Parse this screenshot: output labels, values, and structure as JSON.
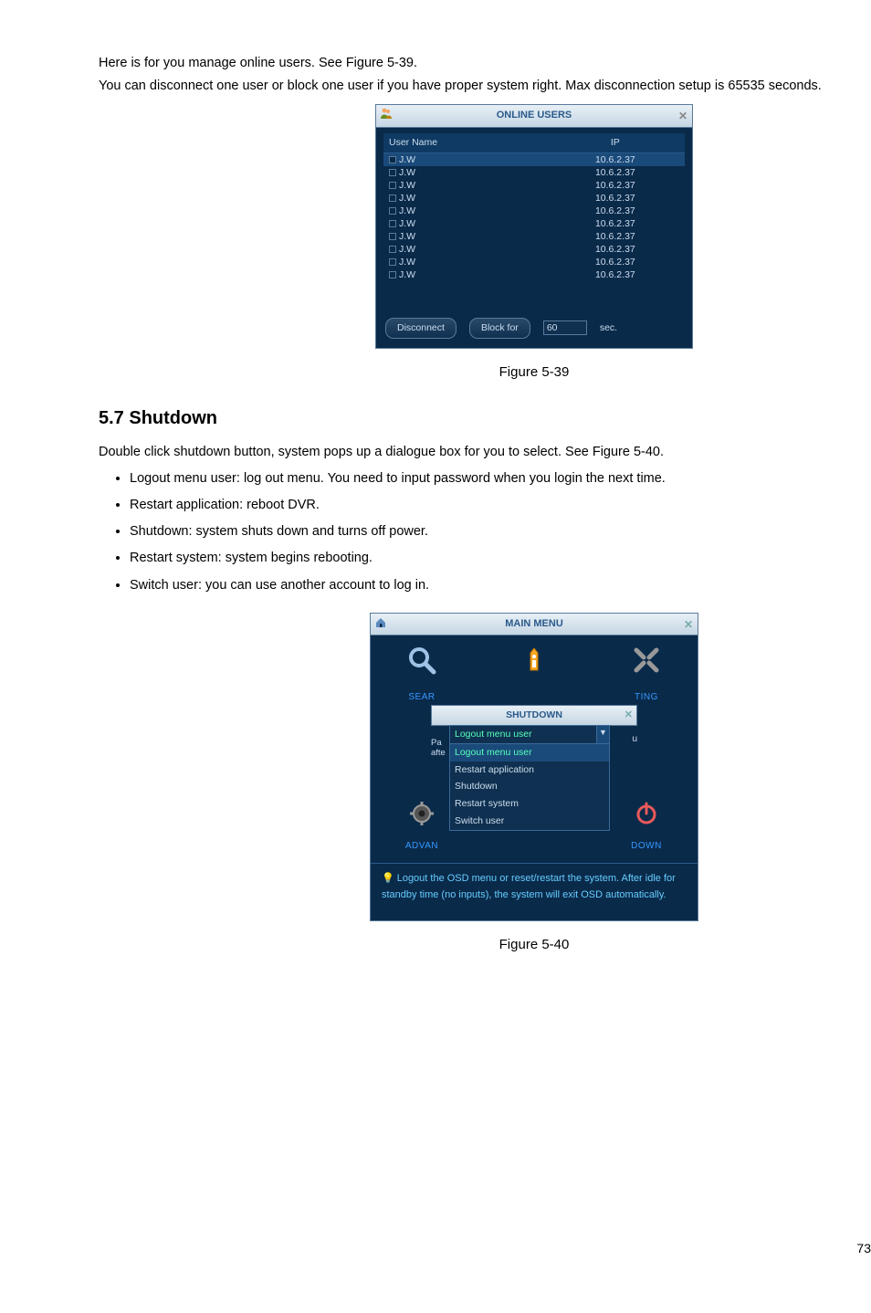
{
  "intro": {
    "p1": "Here is for you manage online users. See Figure 5-39.",
    "p2": "You can disconnect one user or block one user if you have proper system right. Max disconnection setup is 65535 seconds."
  },
  "online_users": {
    "title": "ONLINE USERS",
    "columns": {
      "user": "User Name",
      "ip": "IP"
    },
    "rows": [
      {
        "user": "J.W",
        "ip": "10.6.2.37",
        "selected": true
      },
      {
        "user": "J.W",
        "ip": "10.6.2.37"
      },
      {
        "user": "J.W",
        "ip": "10.6.2.37"
      },
      {
        "user": "J.W",
        "ip": "10.6.2.37"
      },
      {
        "user": "J.W",
        "ip": "10.6.2.37"
      },
      {
        "user": "J.W",
        "ip": "10.6.2.37"
      },
      {
        "user": "J.W",
        "ip": "10.6.2.37"
      },
      {
        "user": "J.W",
        "ip": "10.6.2.37"
      },
      {
        "user": "J.W",
        "ip": "10.6.2.37"
      },
      {
        "user": "J.W",
        "ip": "10.6.2.37"
      }
    ],
    "disconnect": "Disconnect",
    "block_for": "Block for",
    "block_value": "60",
    "sec_label": "sec."
  },
  "fig1_caption": "Figure 5-39",
  "section": {
    "heading": "5.7  Shutdown",
    "intro": "Double click shutdown button, system pops up a dialogue box for you to select. See Figure 5-40.",
    "bullets": [
      "Logout menu user: log out menu. You need to input password when you login the next time.",
      "Restart application: reboot DVR.",
      "Shutdown: system shuts down and turns off power.",
      " Restart system: system begins rebooting.",
      "Switch user: you can use another account to log in."
    ]
  },
  "main_menu": {
    "title": "MAIN MENU",
    "row1": {
      "left": "SEAR",
      "center": "",
      "right": "TING"
    },
    "shutdown_title": "SHUTDOWN",
    "dropdown_selected": "Logout menu user",
    "dropdown_options": [
      "Logout menu user",
      "Restart application",
      "Shutdown",
      "Restart system",
      "Switch user"
    ],
    "left_small1": "Pa",
    "left_small2": "afte",
    "right_small": "u",
    "row2": {
      "left": "ADVAN",
      "right": "DOWN"
    },
    "tip": "Logout the OSD menu or reset/restart the system. After idle for standby time (no inputs), the system will exit OSD automatically."
  },
  "fig2_caption": "Figure 5-40",
  "page_number": "73"
}
